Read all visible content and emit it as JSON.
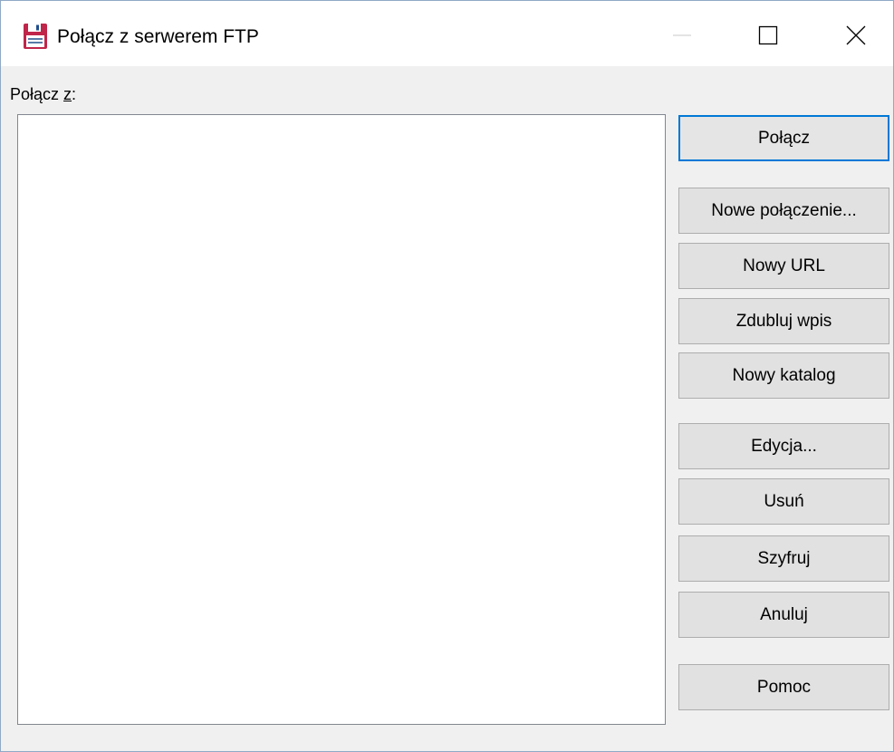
{
  "window": {
    "title": "Połącz z serwerem FTP",
    "icon": "floppy-disk-icon",
    "controls": {
      "minimize_icon": "minimize-icon",
      "maximize_icon": "maximize-icon",
      "close_icon": "close-icon"
    }
  },
  "connect_list": {
    "label_prefix": "Połącz ",
    "label_mnemonic": "z",
    "label_suffix": ":",
    "items": []
  },
  "buttons": {
    "connect": "Połącz",
    "new_connection": "Nowe połączenie...",
    "new_url": "Nowy URL",
    "duplicate_entry": "Zdubluj wpis",
    "new_folder": "Nowy katalog",
    "edit": "Edycja...",
    "delete": "Usuń",
    "encrypt": "Szyfruj",
    "cancel": "Anuluj",
    "help": "Pomoc"
  },
  "colors": {
    "accent": "#0078d7",
    "button_face": "#e1e1e1",
    "dialog_background": "#f0f0f0",
    "icon_floppy": "#c0254a"
  }
}
